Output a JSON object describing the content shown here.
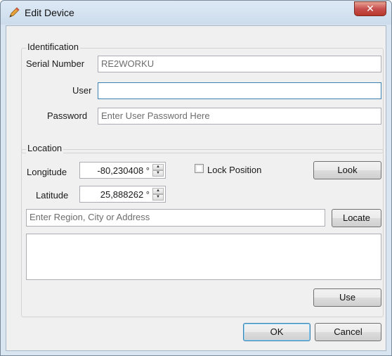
{
  "window": {
    "title": "Edit Device",
    "close_glyph": "✕"
  },
  "identification": {
    "legend": "Identification",
    "serial_label": "Serial Number",
    "serial_value": "RE2WORKU",
    "user_label": "User",
    "user_value": "",
    "password_label": "Password",
    "password_placeholder": "Enter User Password Here"
  },
  "location": {
    "legend": "Location",
    "longitude_label": "Longitude",
    "longitude_value": "-80,230408 °",
    "latitude_label": "Latitude",
    "latitude_value": "25,888262 °",
    "lock_label": "Lock Position",
    "lock_checked": false,
    "look_button": "Look",
    "address_placeholder": "Enter Region, City or Address",
    "locate_button": "Locate",
    "use_button": "Use"
  },
  "footer": {
    "ok_button": "OK",
    "cancel_button": "Cancel"
  },
  "icons": {
    "title": "pencil-icon",
    "spin_up": "▲",
    "spin_down": "▼"
  }
}
